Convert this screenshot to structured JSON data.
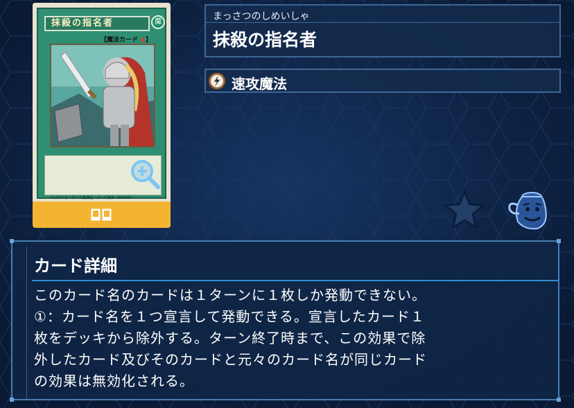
{
  "card": {
    "reading": "まっさつのしめいしゃ",
    "name": "抹殺の指名者",
    "type_label": "速攻魔法",
    "plate_name": "抹殺の指名者",
    "plate_type": "【魔法カード",
    "attribute_glyph": "魔",
    "copyright": "©スタジオ・ダイス/集英社・テレビ東京・KONAMI"
  },
  "detail": {
    "title": "カード詳細",
    "text_lines": [
      "このカード名のカードは１ターンに１枚しか発動できない。",
      "①：カード名を１つ宣言して発動できる。宣言したカード１",
      "枚をデッキから除外する。ターン終了時まで、この効果で除",
      "外したカード及びそのカードと元々のカード名が同じカード",
      "の効果は無効化される。"
    ]
  },
  "icons": {
    "zoom": "zoom-in-icon",
    "link": "link-cards-icon",
    "spell": "quick-play-spell-icon",
    "favorite": "star-icon",
    "pot": "pot-of-greed-icon"
  },
  "colors": {
    "background": "#0f2242",
    "panel_border": "#3f6896",
    "accent_gold": "#f2b431",
    "card_green": "#2f8f72",
    "title_underline": "#2f8ed0"
  }
}
